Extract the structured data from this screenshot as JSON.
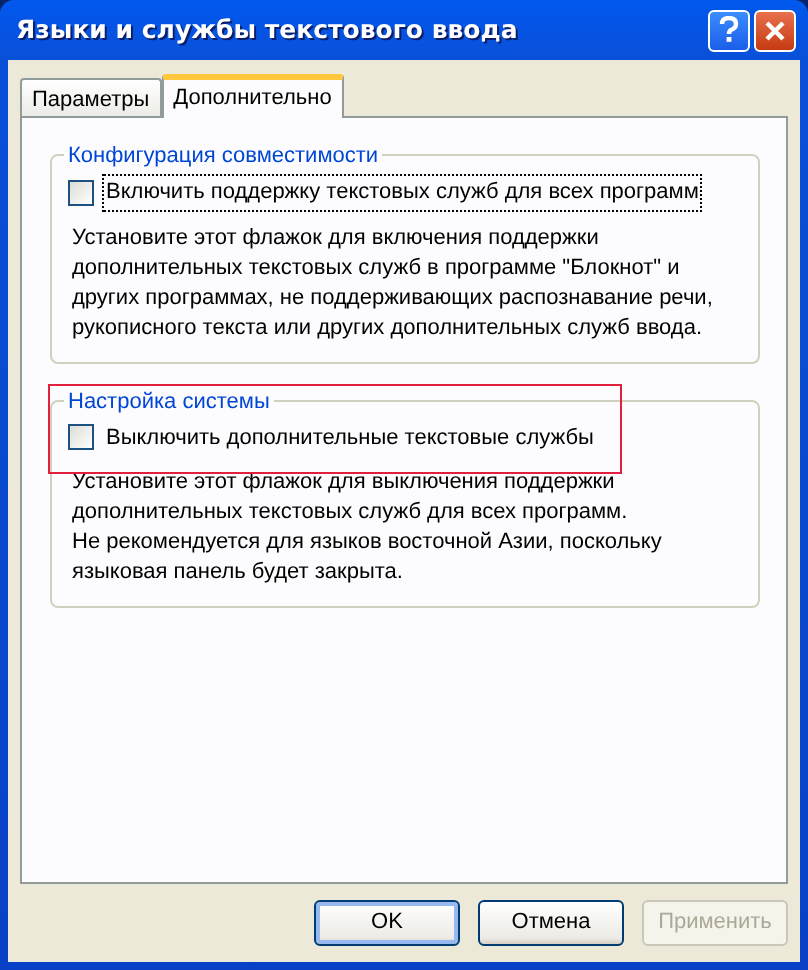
{
  "window": {
    "title": "Языки и службы текстового ввода"
  },
  "tabs": [
    {
      "label": "Параметры",
      "selected": false
    },
    {
      "label": "Дополнительно",
      "selected": true
    }
  ],
  "groups": [
    {
      "title": "Конфигурация совместимости",
      "highlighted": false,
      "checkbox": {
        "label": "Включить поддержку текстовых служб для всех программ",
        "checked": false,
        "focused": true
      },
      "description": "Установите этот флажок для включения поддержки дополнительных текстовых служб в программе \"Блокнот\" и других программах, не поддерживающих распознавание речи, рукописного текста или других дополнительных служб ввода."
    },
    {
      "title": "Настройка системы",
      "highlighted": true,
      "checkbox": {
        "label": "Выключить дополнительные текстовые службы",
        "checked": false,
        "focused": false
      },
      "description": "Установите этот флажок для выключения поддержки дополнительных текстовых служб для всех программ.\nНе рекомендуется для языков восточной Азии, поскольку языковая панель будет закрыта."
    }
  ],
  "buttons": [
    {
      "label": "OK",
      "default": true,
      "disabled": false
    },
    {
      "label": "Отмена",
      "default": false,
      "disabled": false
    },
    {
      "label": "Применить",
      "default": false,
      "disabled": true
    }
  ]
}
